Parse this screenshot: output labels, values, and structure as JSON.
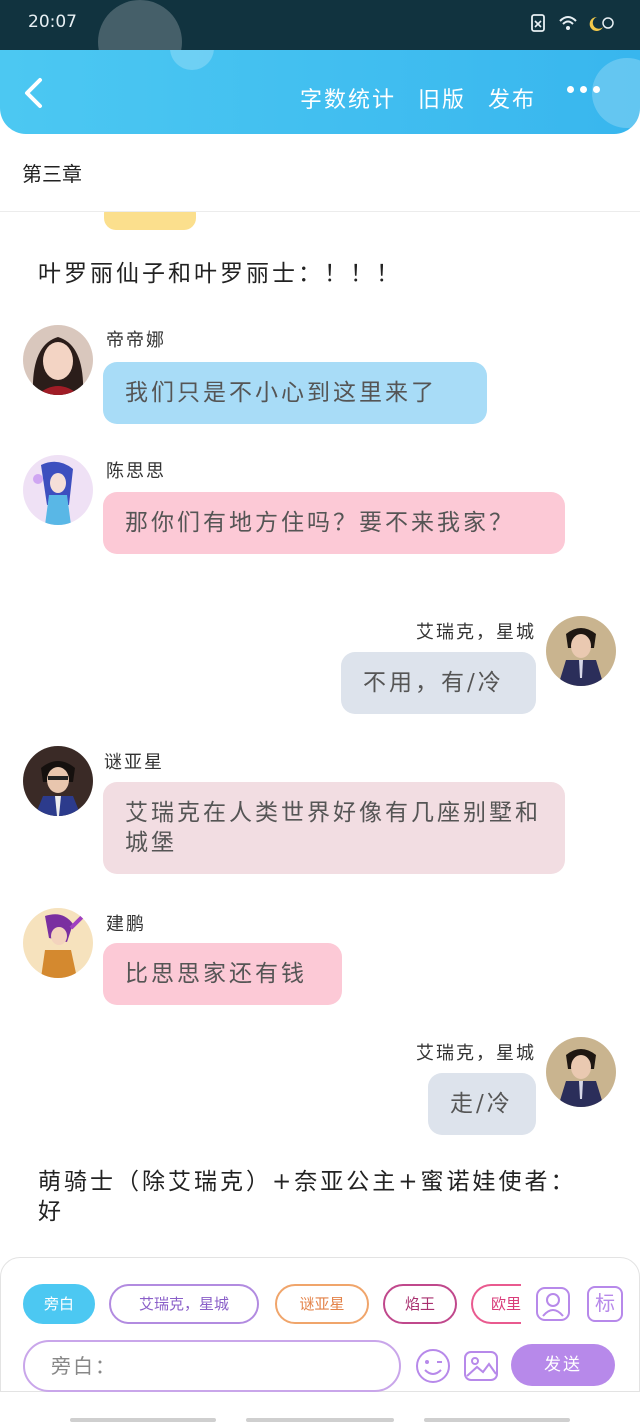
{
  "status_bar": {
    "time": "20:07"
  },
  "header": {
    "actions": [
      "字数统计",
      "旧版",
      "发布"
    ]
  },
  "chapter": {
    "title": "第三章"
  },
  "messages": {
    "narration_1": "叶罗丽仙子和叶罗丽士：！！！",
    "m1": {
      "speaker": "帝帝娜",
      "text": "我们只是不小心到这里来了"
    },
    "m2": {
      "speaker": "陈思思",
      "text": "那你们有地方住吗？要不来我家？"
    },
    "m3": {
      "speaker": "艾瑞克，星城",
      "text": "不用，有/冷"
    },
    "m4": {
      "speaker": "谜亚星",
      "text": "艾瑞克在人类世界好像有几座别墅和城堡"
    },
    "m5": {
      "speaker": "建鹏",
      "text": "比思思家还有钱"
    },
    "m6": {
      "speaker": "艾瑞克，星城",
      "text": "走/冷"
    },
    "narration_2": "萌骑士（除艾瑞克）+奈亚公主+蜜诺娃使者：好"
  },
  "composer": {
    "roles": [
      "旁白",
      "艾瑞克，星城",
      "谜亚星",
      "焰王",
      "欧里"
    ],
    "input_placeholder": "旁白：",
    "send_label": "发送",
    "tag_label": "标"
  }
}
